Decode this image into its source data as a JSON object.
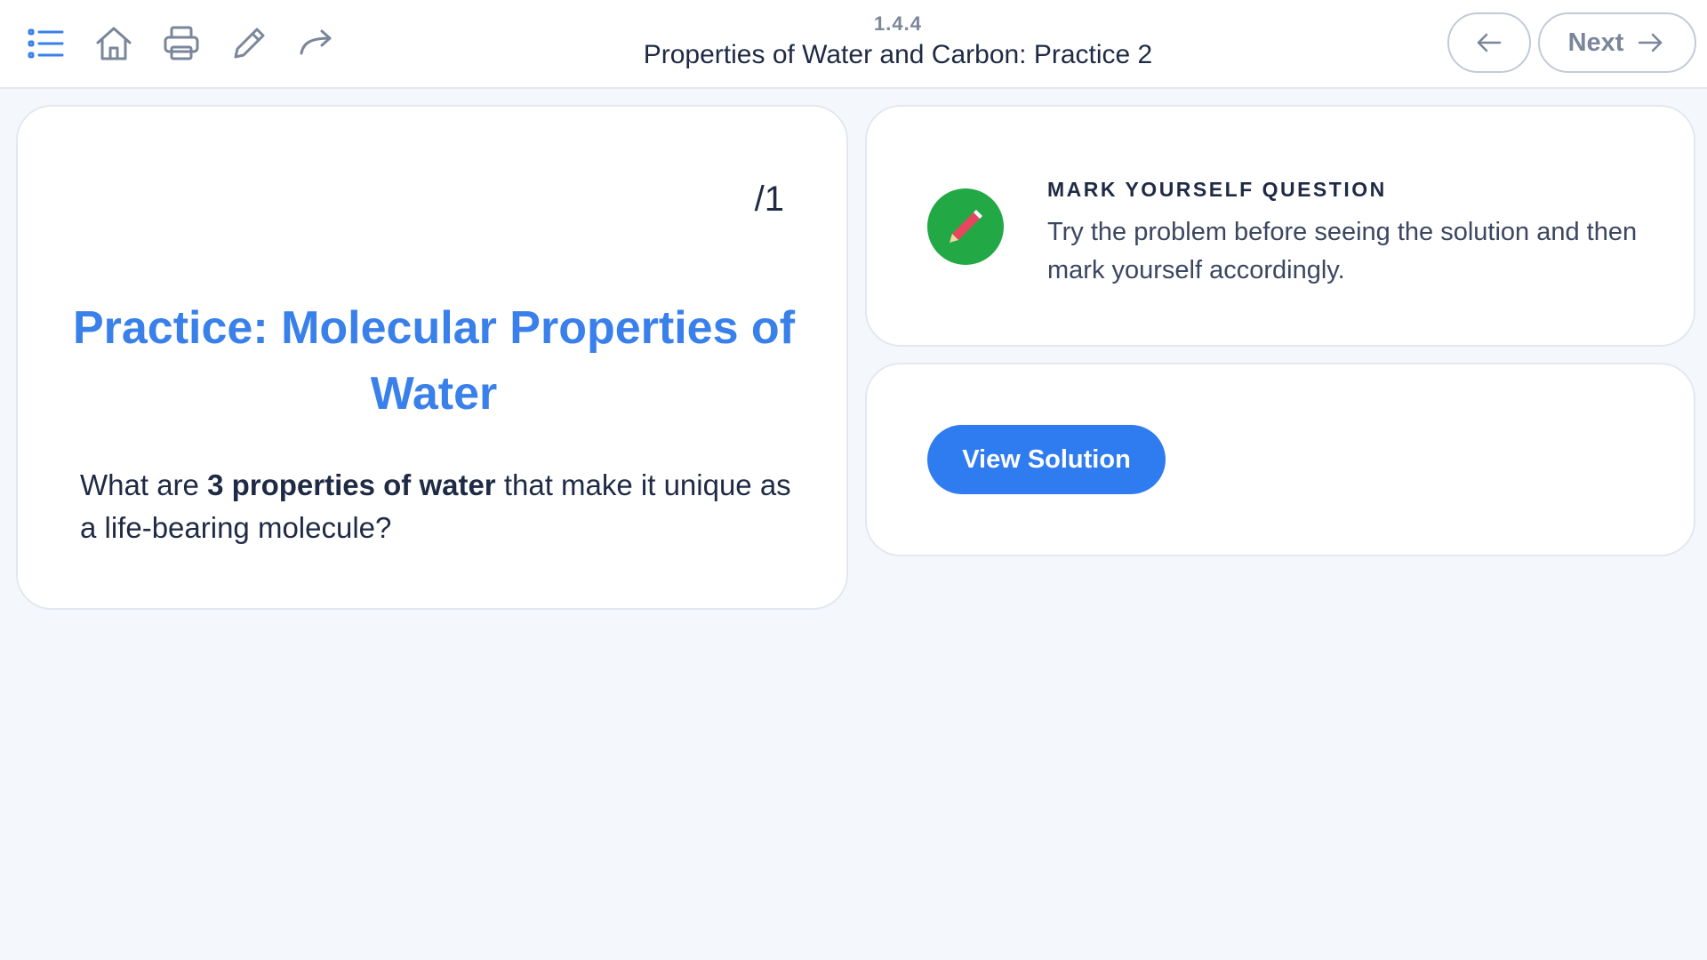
{
  "header": {
    "section_number": "1.4.4",
    "title": "Properties of Water and Carbon: Practice 2",
    "toolbar_icons": [
      "list-icon",
      "home-icon",
      "print-icon",
      "pencil-icon",
      "share-icon"
    ],
    "next_label": "Next"
  },
  "question": {
    "score": "/1",
    "title": "Practice: Molecular Properties of Water",
    "text_before": "What are ",
    "text_bold": "3 properties of water",
    "text_after": " that make it unique as a life-bearing molecule?"
  },
  "mark_yourself": {
    "icon": "pencil-icon",
    "heading": "MARK YOURSELF QUESTION",
    "description": "Try the problem before seeing the solution and then mark yourself accordingly."
  },
  "solution": {
    "button_label": "View Solution"
  },
  "colors": {
    "accent_blue": "#3a80ea",
    "button_blue": "#2f7cf0",
    "badge_green": "#22a845",
    "background": "#f4f7fb"
  }
}
